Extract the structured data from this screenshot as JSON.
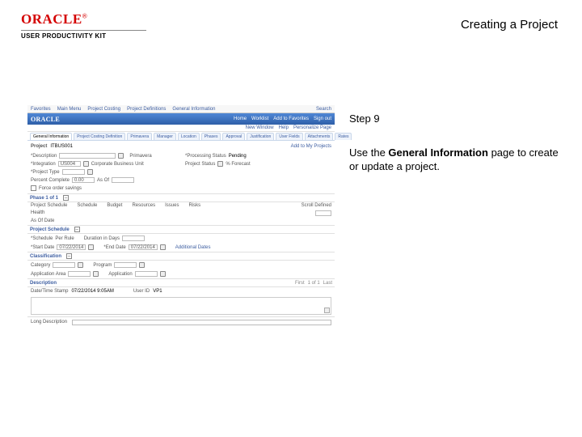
{
  "brand": {
    "logo": "ORACLE",
    "reg": "®",
    "sub": "USER PRODUCTIVITY KIT"
  },
  "doc": {
    "title": "Creating a Project"
  },
  "instr": {
    "step": "Step 9",
    "line_pre": "Use the ",
    "bold": "General Information",
    "line_post": " page to create or update a project."
  },
  "shot": {
    "topnav": {
      "items": [
        "Favorites",
        "Main Menu",
        "Project Costing",
        "Project Definitions",
        "General Information"
      ],
      "right": "Search"
    },
    "orabar": {
      "links": [
        "Home",
        "Worklist",
        "Add to Favorites",
        "Sign out"
      ]
    },
    "crumbs": {
      "items": [
        "New Window",
        "Help",
        "Personalize Page"
      ]
    },
    "tabs": {
      "items": [
        "General Information",
        "Project Costing Definition",
        "Primavera",
        "Manager",
        "Location",
        "Phases",
        "Approval",
        "Justification",
        "User Fields"
      ],
      "right": [
        "Attachments",
        "Rates"
      ]
    },
    "project": {
      "label": "Project",
      "value": "ITBUS001",
      "save": "Add to My Projects"
    },
    "fields": {
      "desc_label": "*Description",
      "desc_val": "",
      "int_label": "*Integration",
      "int_val": "US004",
      "int_hint": "Corporate Business Unit",
      "ptype_label": "*Project Type",
      "ptype_val": "",
      "ptype_hint": "",
      "pct_label": "Percent Complete",
      "pct_val": "0.00",
      "asof_label": "As Of",
      "force_label": "Force order savings",
      "pstatus_label": "*Processing Status",
      "pstatus_val": "Pending",
      "prstat_label": "Project Status",
      "prstat_icon": "%",
      "fcst_label": "% Forecast"
    },
    "phase": {
      "bar": "Phase 1 of 1",
      "cols": [
        "Project Schedule",
        "Schedule",
        "Budget",
        "Resources",
        "Issues",
        "Risks"
      ],
      "scroll": "Scroll Defined",
      "health": "Health",
      "asof": "As Of Date"
    },
    "psched": {
      "title": "Project Schedule",
      "sched_label": "*Schedule",
      "sched_val": "Per Rule",
      "dur_label": "Duration in Days",
      "start_label": "*Start Date",
      "start_val": "07/22/2014",
      "end_label": "*End Date",
      "end_val": "07/22/2014",
      "add_label": "Additional Dates"
    },
    "class": {
      "title": "Classification",
      "cat_label": "Category",
      "own_label": "Program",
      "appbu_label": "Application Area",
      "appl_label": "Application"
    },
    "desc": {
      "title": "Description",
      "pager": [
        "First",
        "1 of 1",
        "Last"
      ],
      "dt_label": "Date/Time Stamp",
      "dt_val": "07/22/2014 9:05AM",
      "user_label": "User ID",
      "user_val": "VP1"
    },
    "footer": {
      "long": "Long Description"
    }
  }
}
